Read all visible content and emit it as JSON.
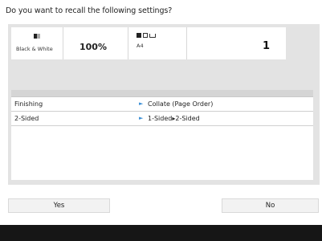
{
  "dialog": {
    "question": "Do you want to recall the following settings?"
  },
  "summary": {
    "color_mode": "Black & White",
    "zoom": "100%",
    "paper_size": "A4",
    "copies": "1"
  },
  "settings": [
    {
      "name": "Finishing",
      "value": "Collate (Page Order)"
    },
    {
      "name": "2-Sided",
      "value": "1-Sided▸2-Sided"
    }
  ],
  "buttons": {
    "yes_label": "Yes",
    "no_label": "No"
  },
  "colors": {
    "panel_bg": "#e3e3e3",
    "accent_arrow": "#3b8fd6",
    "bottom_bar": "#161616"
  },
  "icons": {
    "color_mode": "black-white-icon",
    "paper": "paper-select-icon",
    "arrow": "triangle-right-icon"
  }
}
